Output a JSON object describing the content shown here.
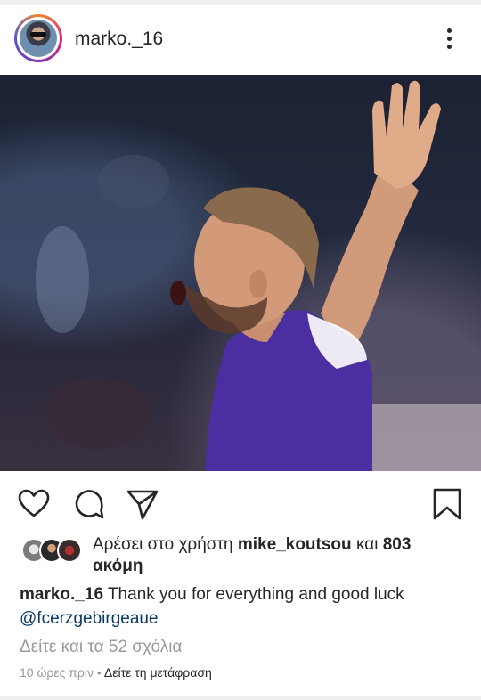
{
  "post": {
    "username": "marko._16",
    "image_icon": "photo-placeholder",
    "likes": {
      "prefix": "Αρέσει στο χρήστη",
      "liker": "mike_koutsou",
      "middle": "και",
      "count": "803",
      "suffix": "ακόμη"
    },
    "caption": {
      "username": "marko._16",
      "text": "Thank you for everything and good luck",
      "mention": "@fcerzgebirgeaue"
    },
    "view_comments": "Δείτε και τα 52 σχόλια",
    "timestamp": "10 ώρες πριν",
    "separator": "•",
    "translate_link": "Δείτε τη μετάφραση"
  },
  "icons": {
    "more": "more-vertical-icon",
    "like": "heart-outline-icon",
    "comment": "comment-bubble-icon",
    "share": "paper-plane-icon",
    "save": "bookmark-outline-icon"
  },
  "colors": {
    "text": "#262626",
    "secondary": "#999999",
    "mention": "#0b3a68",
    "jersey": "#4b2fa0"
  }
}
